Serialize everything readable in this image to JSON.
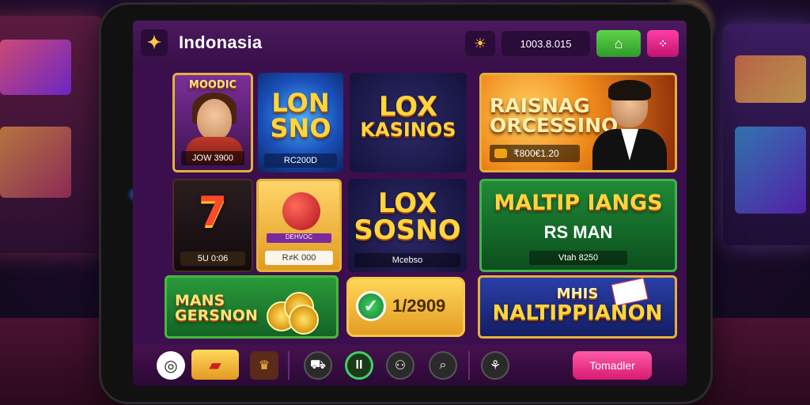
{
  "header": {
    "logo_glyph": "✦",
    "title": "Indonasia",
    "balance": "1003.8.015",
    "sun_icon": "☀",
    "home_icon": "⌂",
    "menu_icon": "⁘"
  },
  "tiles": {
    "queen": {
      "name": "MOODIC",
      "caption": "​JOW 3900"
    },
    "lonsno": {
      "name_line1": "LON",
      "name_line2": "SNO",
      "caption": "RC200D"
    },
    "lox1": {
      "name_line1": "LOX",
      "name_line2": "KASINOS"
    },
    "raisnag": {
      "name_line1": "RAISNAG",
      "name_line2": "ORCESSINO",
      "caption": "₹800€1.20"
    },
    "seven": {
      "name": "7",
      "caption": "5U 0:06"
    },
    "ball": {
      "ribbon": "DEHVOC",
      "caption": "R≠K 000"
    },
    "lox2": {
      "name_line1": "LOX",
      "name_line2": "SOSNO",
      "caption": "Mcebso"
    },
    "maltip": {
      "name": "MALTIP IANGS",
      "sub": "RS MAN",
      "caption": "Vtah 8250"
    },
    "mans": {
      "name_line1": "MANS",
      "name_line2": "GERSNON"
    },
    "gold": {
      "check": "✓",
      "value": "1/2909"
    },
    "nalti": {
      "name_line1": "MHIS",
      "name_line2": "NALTIPPIANON"
    }
  },
  "bottombar": {
    "location_icon": "◎",
    "ticket_icon": "▰",
    "trophy_icon": "♛",
    "icons": [
      "⛟",
      "II",
      "⚇",
      "⌕",
      "⚘"
    ],
    "cta": "Tomadler"
  }
}
